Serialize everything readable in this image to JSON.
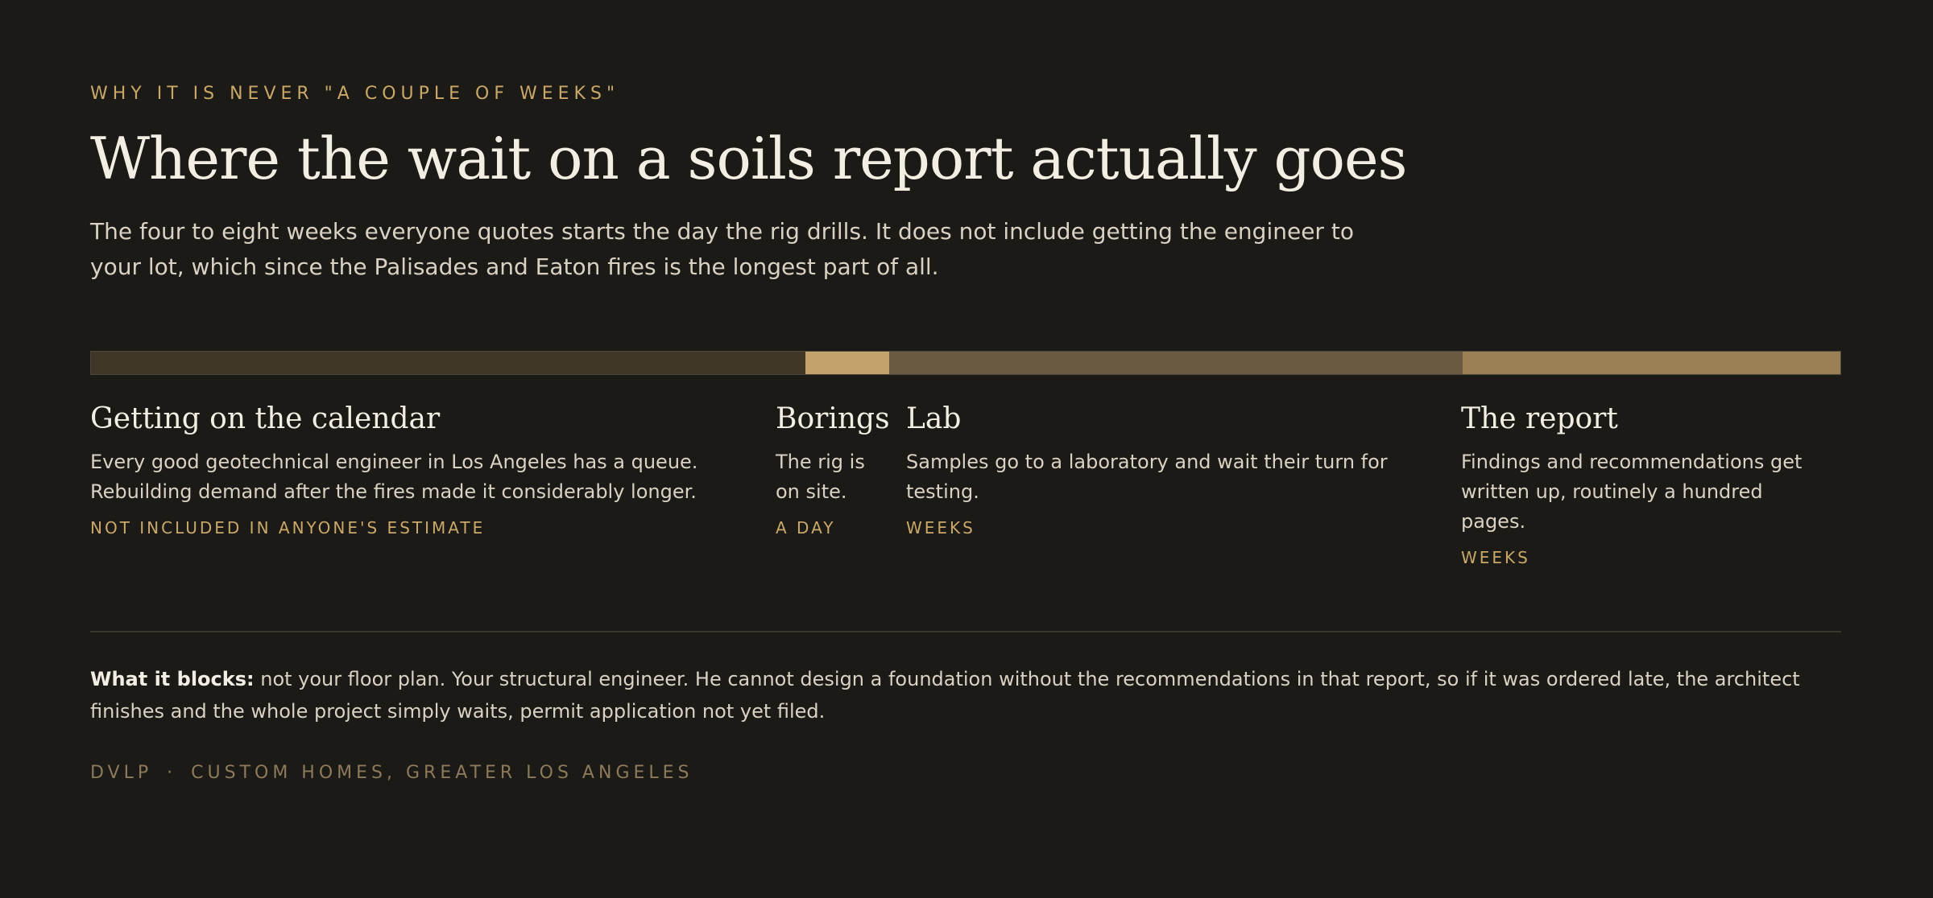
{
  "header": {
    "eyebrow": "WHY IT IS NEVER \"A COUPLE OF WEEKS\"",
    "title": "Where the wait on a soils report actually goes",
    "intro": "The four to eight weeks everyone quotes starts the day the rig drills. It does not include getting the engineer to your lot, which since the Palisades and Eaton fires is the longest part of all."
  },
  "timeline": {
    "colors": {
      "calendar": "#403628",
      "borings": "#c3a26b",
      "lab": "#695a41",
      "report": "#9a7f55"
    },
    "stages": [
      {
        "title": "Getting on the calendar",
        "description": "Every good geotechnical engineer in Los Angeles has a queue. Rebuilding demand after the fires made it considerably longer.",
        "duration": "NOT INCLUDED IN ANYONE'S ESTIMATE"
      },
      {
        "title": "Borings",
        "description": "The rig is on site.",
        "duration": "A DAY"
      },
      {
        "title": "Lab",
        "description": "Samples go to a laboratory and wait their turn for testing.",
        "duration": "WEEKS"
      },
      {
        "title": "The report",
        "description": "Findings and recommendations get written up, routinely a hundred pages.",
        "duration": "WEEKS"
      }
    ]
  },
  "blocks": {
    "lead": "What it blocks:",
    "text": " not your floor plan. Your structural engineer. He cannot design a foundation without the recommendations in that report, so if it was ordered late, the architect finishes and the whole project simply waits, permit application not yet filed."
  },
  "footer": {
    "brand": "DVLP",
    "separator": "·",
    "tagline": "CUSTOM HOMES, GREATER LOS ANGELES"
  }
}
